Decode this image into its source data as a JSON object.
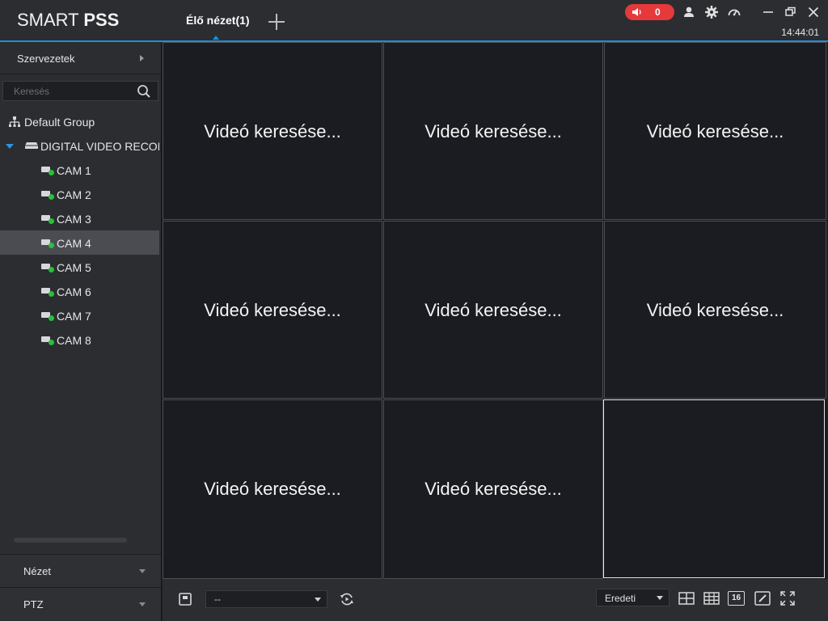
{
  "app": {
    "logo_light": "SMART ",
    "logo_bold": "PSS",
    "clock": "14:44:01"
  },
  "tabs": [
    {
      "label": "Élő nézet(1)",
      "active": true
    }
  ],
  "header_icons": [
    "speaker-icon",
    "user-icon",
    "gear-icon",
    "gauge-icon",
    "minimize-icon",
    "restore-icon",
    "close-icon"
  ],
  "alarm": {
    "count": "0",
    "color": "#e5393b"
  },
  "colors": {
    "accent": "#1f8fd6",
    "online": "#27c13a",
    "selected_row": "#4a4c52"
  },
  "sidebar": {
    "org_label": "Szervezetek",
    "search_placeholder": "Keresés",
    "tree": {
      "group": "Default Group",
      "device": "DIGITAL VIDEO RECORDER",
      "cameras": [
        "CAM 1",
        "CAM 2",
        "CAM 3",
        "CAM 4",
        "CAM 5",
        "CAM 6",
        "CAM 7",
        "CAM 8"
      ],
      "selected_camera": "CAM 4"
    },
    "panels": [
      "Nézet",
      "PTZ"
    ]
  },
  "grid": {
    "message": "Videó keresése...",
    "cells": [
      {
        "message": "Videó keresése..."
      },
      {
        "message": "Videó keresése..."
      },
      {
        "message": "Videó keresése..."
      },
      {
        "message": "Videó keresése..."
      },
      {
        "message": "Videó keresése..."
      },
      {
        "message": "Videó keresése..."
      },
      {
        "message": "Videó keresése..."
      },
      {
        "message": "Videó keresése..."
      },
      {
        "message": ""
      }
    ]
  },
  "toolbar": {
    "view_select_value": "--",
    "ratio_select_value": "Eredeti",
    "split_16_label": "16"
  }
}
